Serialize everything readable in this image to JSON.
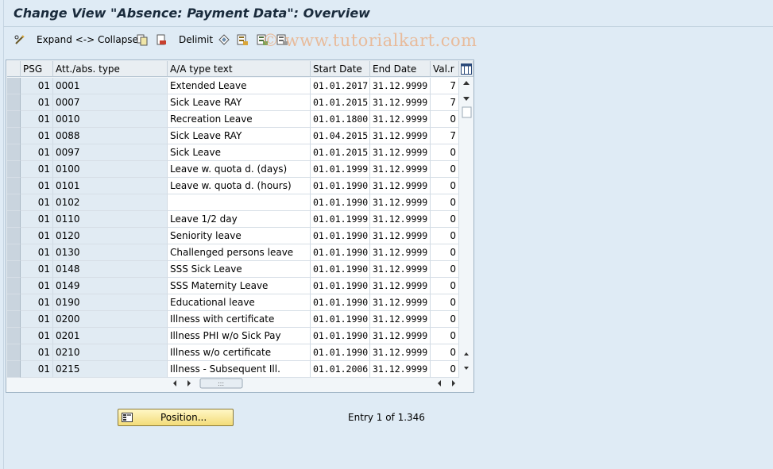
{
  "window": {
    "title": "Change View \"Absence: Payment Data\": Overview"
  },
  "watermark": "© www.tutorialkart.com",
  "toolbar": {
    "expand_collapse_label": "Expand <-> Collapse",
    "delimit_label": "Delimit"
  },
  "table": {
    "columns": [
      "PSG",
      "Att./abs. type",
      "A/A type text",
      "Start Date",
      "End Date",
      "Val.r"
    ],
    "rows": [
      {
        "psg": "01",
        "type": "0001",
        "text": "Extended Leave",
        "start": "01.01.2017",
        "end": "31.12.9999",
        "valr": "7"
      },
      {
        "psg": "01",
        "type": "0007",
        "text": "Sick Leave RAY",
        "start": "01.01.2015",
        "end": "31.12.9999",
        "valr": "7"
      },
      {
        "psg": "01",
        "type": "0010",
        "text": "Recreation Leave",
        "start": "01.01.1800",
        "end": "31.12.9999",
        "valr": "0"
      },
      {
        "psg": "01",
        "type": "0088",
        "text": "Sick Leave RAY",
        "start": "01.04.2015",
        "end": "31.12.9999",
        "valr": "7"
      },
      {
        "psg": "01",
        "type": "0097",
        "text": "Sick Leave",
        "start": "01.01.2015",
        "end": "31.12.9999",
        "valr": "0"
      },
      {
        "psg": "01",
        "type": "0100",
        "text": "Leave w. quota d. (days)",
        "start": "01.01.1999",
        "end": "31.12.9999",
        "valr": "0"
      },
      {
        "psg": "01",
        "type": "0101",
        "text": "Leave w. quota d. (hours)",
        "start": "01.01.1990",
        "end": "31.12.9999",
        "valr": "0"
      },
      {
        "psg": "01",
        "type": "0102",
        "text": "",
        "start": "01.01.1990",
        "end": "31.12.9999",
        "valr": "0"
      },
      {
        "psg": "01",
        "type": "0110",
        "text": "Leave 1/2 day",
        "start": "01.01.1999",
        "end": "31.12.9999",
        "valr": "0"
      },
      {
        "psg": "01",
        "type": "0120",
        "text": "Seniority leave",
        "start": "01.01.1990",
        "end": "31.12.9999",
        "valr": "0"
      },
      {
        "psg": "01",
        "type": "0130",
        "text": "Challenged persons leave",
        "start": "01.01.1990",
        "end": "31.12.9999",
        "valr": "0"
      },
      {
        "psg": "01",
        "type": "0148",
        "text": "SSS Sick Leave",
        "start": "01.01.1990",
        "end": "31.12.9999",
        "valr": "0"
      },
      {
        "psg": "01",
        "type": "0149",
        "text": "SSS Maternity Leave",
        "start": "01.01.1990",
        "end": "31.12.9999",
        "valr": "0"
      },
      {
        "psg": "01",
        "type": "0190",
        "text": "Educational leave",
        "start": "01.01.1990",
        "end": "31.12.9999",
        "valr": "0"
      },
      {
        "psg": "01",
        "type": "0200",
        "text": "Illness with certificate",
        "start": "01.01.1990",
        "end": "31.12.9999",
        "valr": "0"
      },
      {
        "psg": "01",
        "type": "0201",
        "text": "Illness PHI w/o Sick Pay",
        "start": "01.01.1990",
        "end": "31.12.9999",
        "valr": "0"
      },
      {
        "psg": "01",
        "type": "0210",
        "text": "Illness w/o certificate",
        "start": "01.01.1990",
        "end": "31.12.9999",
        "valr": "0"
      },
      {
        "psg": "01",
        "type": "0215",
        "text": "Illness - Subsequent Ill.",
        "start": "01.01.2006",
        "end": "31.12.9999",
        "valr": "0"
      }
    ]
  },
  "footer": {
    "position_label": "Position...",
    "entry_text": "Entry 1 of 1.346"
  },
  "colors": {
    "background": "#dfebf5",
    "button_yellow": "#f3dc78",
    "watermark": "#ee9450"
  }
}
